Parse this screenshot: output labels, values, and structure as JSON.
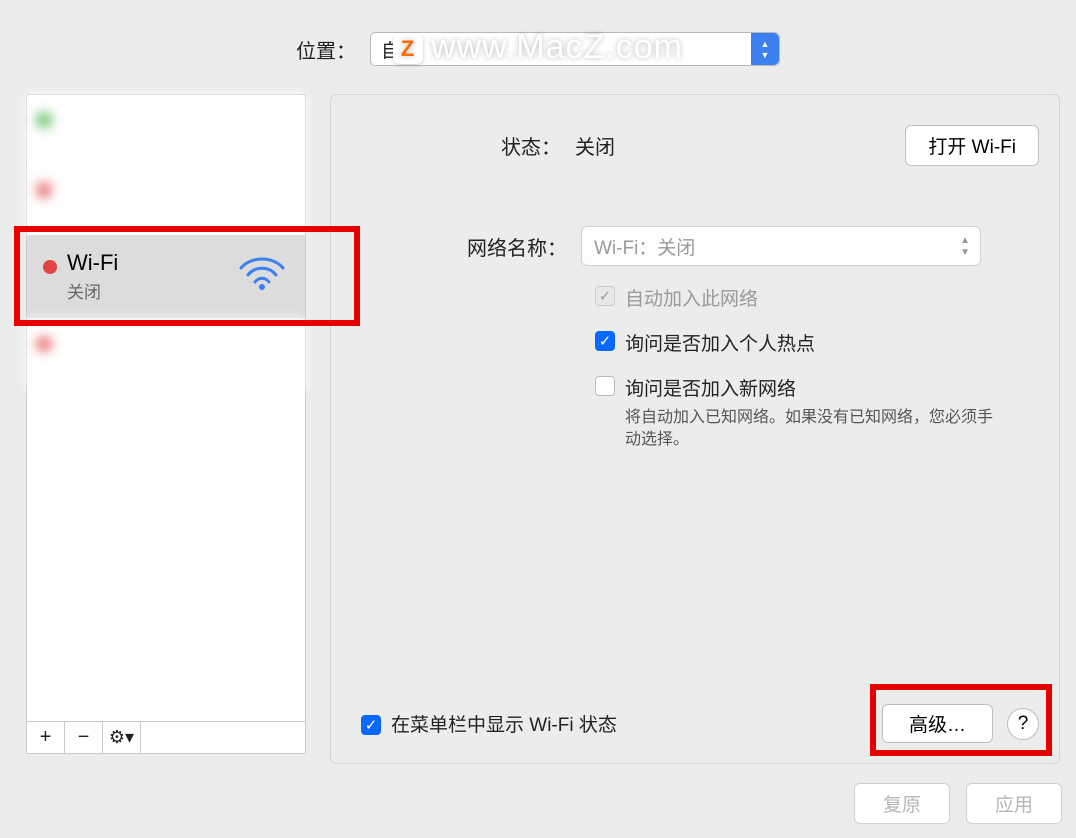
{
  "watermark": "www.MacZ.com",
  "location": {
    "label": "位置：",
    "value": "自动"
  },
  "sidebar": {
    "wifi": {
      "title": "Wi-Fi",
      "sub": "关闭"
    },
    "buttons": {
      "add": "+",
      "remove": "−",
      "gear": "⚙︎▾"
    }
  },
  "main": {
    "status_label": "状态：",
    "status_value": "关闭",
    "wifi_button": "打开 Wi-Fi",
    "network_label": "网络名称：",
    "network_value": "Wi-Fi：关闭",
    "cb_autojoin": "自动加入此网络",
    "cb_hotspot": "询问是否加入个人热点",
    "cb_newnet": "询问是否加入新网络",
    "cb_newnet_desc": "将自动加入已知网络。如果没有已知网络，您必须手动选择。",
    "cb_menubar": "在菜单栏中显示 Wi-Fi 状态",
    "advanced": "高级…",
    "help": "?"
  },
  "footer": {
    "revert": "复原",
    "apply": "应用"
  }
}
